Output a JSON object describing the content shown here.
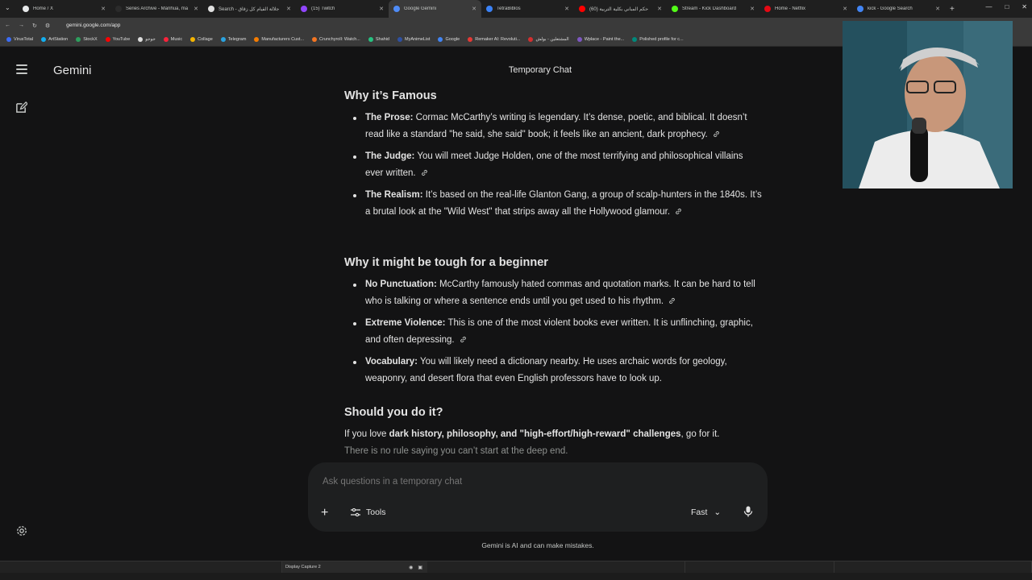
{
  "browser": {
    "tabs": [
      {
        "title": "Home / X",
        "color": "#e7e9ea"
      },
      {
        "title": "Series Archive - Manhua, ma",
        "color": "#2b2b2b"
      },
      {
        "title": "Search - جلالة القيام كل زقاق",
        "color": "#e0e0e0"
      },
      {
        "title": "(15) Twitch",
        "color": "#9146ff"
      },
      {
        "title": "Google Gemini",
        "color": "#4f8cf7",
        "active": true
      },
      {
        "title": "TetraBiblos",
        "color": "#3b82f6"
      },
      {
        "title": "حكم المباني بكلية التربية (60)",
        "color": "#ff0000"
      },
      {
        "title": "Stream - Kick Dashboard",
        "color": "#53fc18"
      },
      {
        "title": "Home - Netflix",
        "color": "#e50914"
      },
      {
        "title": "kick - Google Search",
        "color": "#4285f4"
      }
    ],
    "url": "gemini.google.com/app",
    "bookmarks": [
      {
        "label": "VirusTotal",
        "color": "#3b6cf6"
      },
      {
        "label": "ArtStation",
        "color": "#13aff0"
      },
      {
        "label": "StockX",
        "color": "#2d9f5d"
      },
      {
        "label": "YouTube",
        "color": "#ff0000"
      },
      {
        "label": "جوجو",
        "color": "#dddddd"
      },
      {
        "label": "Music",
        "color": "#fa233b"
      },
      {
        "label": "Collage",
        "color": "#f4b400"
      },
      {
        "label": "Telegram",
        "color": "#2aa3e0"
      },
      {
        "label": "Manufacturers Cust...",
        "color": "#f57c00"
      },
      {
        "label": "Crunchyroll: Watch...",
        "color": "#f47521"
      },
      {
        "label": "Shahid",
        "color": "#26c281"
      },
      {
        "label": "MyAnimeList",
        "color": "#2e51a2"
      },
      {
        "label": "Google",
        "color": "#4285f4"
      },
      {
        "label": "Remaker AI: Revoluti...",
        "color": "#e53935"
      },
      {
        "label": "المشتعلين - بولش",
        "color": "#d32f2f"
      },
      {
        "label": "Wplace - Paint the...",
        "color": "#7e57c2"
      },
      {
        "label": "Polished profile for c...",
        "color": "#00897b"
      }
    ]
  },
  "app": {
    "brand": "Gemini",
    "chat_title": "Temporary Chat"
  },
  "content": {
    "section1": {
      "heading": "Why it’s Famous",
      "items": [
        {
          "bold": "The Prose:",
          "text": " Cormac McCarthy’s writing is legendary. It’s dense, poetic, and biblical. It doesn’t read like a standard \"he said, she said\" book; it feels like an ancient, dark prophecy."
        },
        {
          "bold": "The Judge:",
          "text": " You will meet Judge Holden, one of the most terrifying and philosophical villains ever written."
        },
        {
          "bold": "The Realism:",
          "text": " It’s based on the real-life Glanton Gang, a group of scalp-hunters in the 1840s. It’s a brutal look at the \"Wild West\" that strips away all the Hollywood glamour."
        }
      ]
    },
    "section2": {
      "heading": "Why it might be tough for a beginner",
      "items": [
        {
          "bold": "No Punctuation:",
          "text": " McCarthy famously hated commas and quotation marks. It can be hard to tell who is talking or where a sentence ends until you get used to his rhythm."
        },
        {
          "bold": "Extreme Violence:",
          "text": " This is one of the most violent books ever written. It is unflinching, graphic, and often depressing."
        },
        {
          "bold": "Vocabulary:",
          "text": " You will likely need a dictionary nearby. He uses archaic words for geology, weaponry, and desert flora that even English professors have to look up."
        }
      ]
    },
    "section3": {
      "heading": "Should you do it?",
      "p_prefix": "If you love ",
      "p_bold": "dark history, philosophy, and \"high-effort/high-reward\" challenges",
      "p_suffix": ", go for it.",
      "p_faded": "There is no rule saying you can’t start at the deep end."
    }
  },
  "composer": {
    "placeholder": "Ask questions in a temporary chat",
    "tools_label": "Tools",
    "mode_label": "Fast"
  },
  "disclaimer": "Gemini is AI and can make mistakes.",
  "taskbar": {
    "item_label": "Display Capture 2"
  }
}
